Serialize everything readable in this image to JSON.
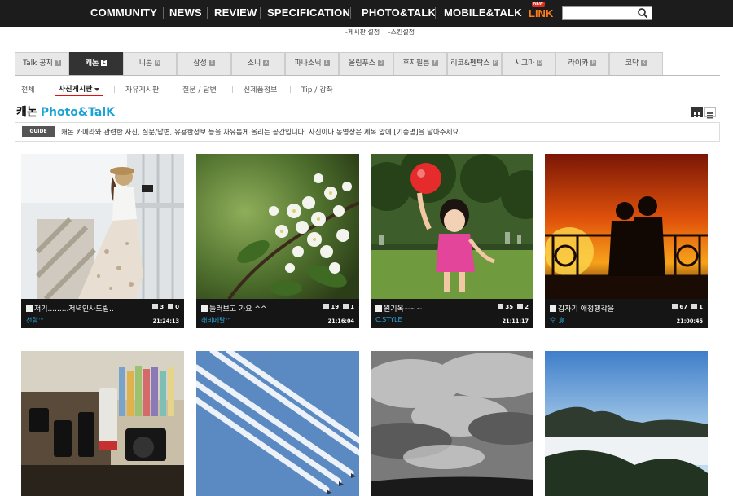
{
  "nav": {
    "items": [
      "COMMUNITY",
      "NEWS",
      "REVIEW",
      "SPECIFICATION",
      "PHOTO&TALK",
      "MOBILE&TALK"
    ],
    "link_label": "LINK",
    "new_badge": "NEW",
    "search_placeholder": "",
    "search_icon": "search-icon"
  },
  "settings": [
    "-게시판 설정",
    "-스킨설정"
  ],
  "brand_tabs": [
    {
      "label": "Talk 공지",
      "key": "T"
    },
    {
      "label": "캐논",
      "key": "C"
    },
    {
      "label": "니콘",
      "key": "N"
    },
    {
      "label": "삼성",
      "key": "S"
    },
    {
      "label": "소니",
      "key": "A"
    },
    {
      "label": "파나소닉",
      "key": "L"
    },
    {
      "label": "올림푸스",
      "key": "O"
    },
    {
      "label": "후지필름",
      "key": "F"
    },
    {
      "label": "리코&펜탁스",
      "key": "P"
    },
    {
      "label": "시그마",
      "key": "D"
    },
    {
      "label": "라이카",
      "key": "M"
    },
    {
      "label": "코닥",
      "key": "K"
    }
  ],
  "active_brand_tab": 1,
  "sub_tabs": [
    "전체",
    "사진게시판",
    "자유게시판",
    "질문 / 답변",
    "신제품정보",
    "Tip / 강좌"
  ],
  "active_sub_tab": 1,
  "board": {
    "title": "캐논",
    "accent": "Photo&TalK",
    "accent_color": "#1ba3d6"
  },
  "guide": {
    "badge": "GUIDE",
    "text": "캐논 카메라와 관련한 사진, 질문/답변, 유용한정보 등을 자유롭게 올리는 공간입니다. 사진이나 동영상은 제목 앞에 [기종명]을 달아주세요."
  },
  "cards": [
    {
      "title": "저기.........저녁인사드립..",
      "comments": "3",
      "likes": "0",
      "author": "천랑™",
      "time": "21:24:13"
    },
    {
      "title": "둘러보고 가요 ^^",
      "comments": "19",
      "likes": "1",
      "author": "해비메탈™",
      "time": "21:16:04"
    },
    {
      "title": "원기옥~~~",
      "comments": "35",
      "likes": "2",
      "author": "C.STYLE",
      "time": "21:11:17"
    },
    {
      "title": "갑자기 애정행각을",
      "comments": "67",
      "likes": "1",
      "author": "空 島",
      "time": "21:00:45"
    }
  ]
}
